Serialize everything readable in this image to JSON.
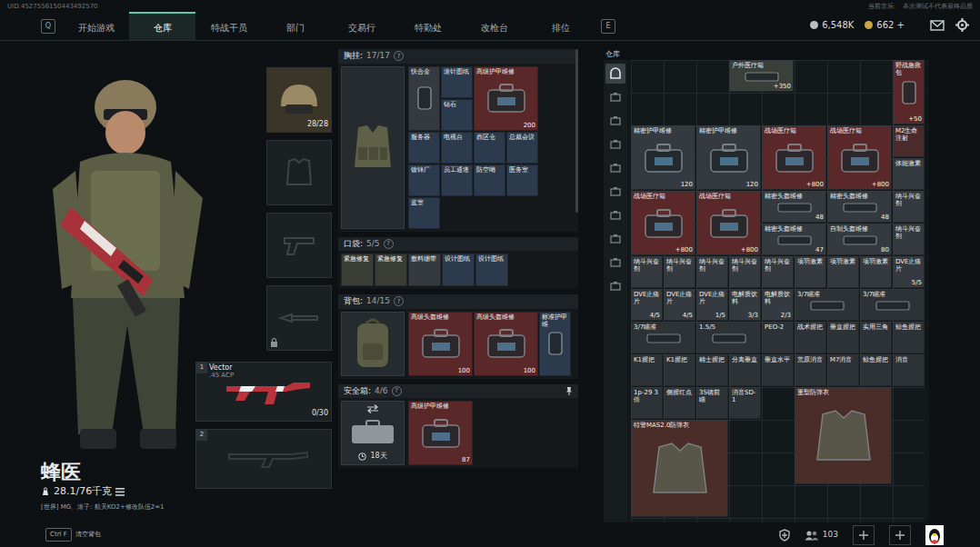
{
  "header": {
    "uid": "UID:4527556150443492570",
    "music_label": "当前音乐:",
    "notice": "本次测试不代表最终品质",
    "currencies": [
      {
        "amount": "6,548K",
        "color": "#b9bec2"
      },
      {
        "amount": "662 +",
        "color": "#c9a640"
      }
    ]
  },
  "tabs": {
    "key_left": "Q",
    "key_right": "E",
    "items": [
      {
        "label": "开始游戏",
        "selected": false
      },
      {
        "label": "仓库",
        "selected": true
      },
      {
        "label": "特战干员",
        "selected": false
      },
      {
        "label": "部门",
        "selected": false
      },
      {
        "label": "交易行",
        "selected": false
      },
      {
        "label": "特勤处",
        "selected": false
      },
      {
        "label": "改枪台",
        "selected": false
      },
      {
        "label": "排位",
        "selected": false
      }
    ]
  },
  "operator": {
    "name": "蜂医",
    "weight": "28.1/76千克",
    "chat": "[世界] MG、滚子: 航天KO2+修改队伍2=1"
  },
  "loadout": {
    "helmet_durability": "28/28",
    "primary": {
      "slot": "1",
      "name": "Vector",
      "caliber": ".45 ACP",
      "ammo": "0/30"
    },
    "secondary": {
      "slot": "2"
    }
  },
  "containers": [
    {
      "title": "胸挂:",
      "capacity": "17/17",
      "help": "?",
      "kind": "rig",
      "items": [
        {
          "name": "快合金",
          "kind": "tall",
          "color": "#343a3f"
        },
        {
          "name": "滚针图纸",
          "kind": "small",
          "color": "#2b3a4c"
        },
        {
          "name": "高级护甲维修",
          "value": "200",
          "kind": "big",
          "color": "#5a2828"
        },
        {
          "name": "钻石",
          "kind": "small",
          "color": "#2b3a4c"
        },
        {
          "name": "服务器",
          "kind": "small",
          "color": "#2b3a4c"
        },
        {
          "name": "电视台",
          "kind": "small",
          "color": "#2b3a4c"
        },
        {
          "name": "西区仓",
          "kind": "small",
          "color": "#2b3a4c"
        },
        {
          "name": "总裁会议",
          "kind": "small",
          "color": "#2b3a4c"
        },
        {
          "name": "镀锌厂",
          "kind": "small",
          "color": "#2b3a4c"
        },
        {
          "name": "员工通道",
          "kind": "small",
          "color": "#2b3a4c"
        },
        {
          "name": "防空哨",
          "kind": "small",
          "color": "#2b3a4c"
        },
        {
          "name": "医务室",
          "kind": "small",
          "color": "#2b3a4c"
        },
        {
          "name": "蓝室",
          "kind": "small",
          "color": "#2b3a4c"
        }
      ]
    },
    {
      "title": "口袋:",
      "capacity": "5/5",
      "help": "?",
      "kind": "pocket",
      "items": [
        {
          "name": "紧急修复",
          "kind": "small",
          "color": "#3a3d33"
        },
        {
          "name": "紧急修复",
          "kind": "small",
          "color": "#3a3d33"
        },
        {
          "name": "敷料绷带",
          "kind": "small",
          "color": "#343a3f"
        },
        {
          "name": "设计图纸",
          "kind": "small",
          "color": "#2b3a4c"
        },
        {
          "name": "设计图纸",
          "kind": "small",
          "color": "#2b3a4c"
        }
      ]
    },
    {
      "title": "背包:",
      "capacity": "14/15",
      "help": "?",
      "kind": "backpack",
      "items": [
        {
          "name": "高级头盔维修",
          "value": "100",
          "kind": "big",
          "color": "#5a2828"
        },
        {
          "name": "高级头盔维修",
          "value": "100",
          "kind": "big",
          "color": "#5a2828"
        },
        {
          "name": "标准护甲维",
          "kind": "tall",
          "color": "#2b3a4c"
        }
      ]
    },
    {
      "title": "安全箱:",
      "capacity": "4/6",
      "help": "?",
      "kind": "safe",
      "timer": "18天",
      "items": [
        {
          "name": "高级护甲维修",
          "value": "87",
          "kind": "big",
          "color": "#5a2828"
        }
      ]
    }
  ],
  "warehouse": {
    "title": "仓库",
    "categories": [
      {
        "selected": true
      },
      {
        "selected": false
      },
      {
        "selected": false
      },
      {
        "selected": false
      },
      {
        "selected": false
      },
      {
        "selected": false
      },
      {
        "selected": false
      },
      {
        "selected": false
      },
      {
        "selected": false
      },
      {
        "selected": false
      }
    ],
    "items": [
      {
        "kind": "empty"
      },
      {
        "kind": "empty"
      },
      {
        "kind": "empty"
      },
      {
        "name": "户外医疗箱",
        "value": "+350",
        "kind": "wide",
        "color": "#3a3f3a"
      },
      {
        "kind": "empty"
      },
      {
        "kind": "empty"
      },
      {
        "kind": "empty"
      },
      {
        "name": "野战急救包",
        "value": "+50",
        "kind": "tall",
        "color": "#5a2828"
      },
      {
        "kind": "empty"
      },
      {
        "kind": "empty"
      },
      {
        "kind": "empty"
      },
      {
        "kind": "empty"
      },
      {
        "kind": "empty"
      },
      {
        "kind": "empty"
      },
      {
        "kind": "empty"
      },
      {
        "kind": "empty"
      },
      {
        "name": "精密护甲维修",
        "value": "120",
        "kind": "big",
        "color": "#343a3f"
      },
      {
        "name": "精密护甲维修",
        "value": "120",
        "kind": "big",
        "color": "#343a3f"
      },
      {
        "name": "战场医疗箱",
        "value": "+800",
        "kind": "big",
        "color": "#5a2828"
      },
      {
        "name": "战场医疗箱",
        "value": "+800",
        "kind": "big",
        "color": "#5a2828"
      },
      {
        "name": "M2生命注射",
        "kind": "small",
        "color": "#4a2a2a"
      },
      {
        "name": "体能激素",
        "kind": "small",
        "color": "#343a3f"
      },
      {
        "name": "战场医疗箱",
        "value": "+800",
        "kind": "big",
        "color": "#5a2828"
      },
      {
        "name": "战场医疗箱",
        "value": "+800",
        "kind": "big",
        "color": "#5a2828"
      },
      {
        "name": "精密头盔维修",
        "value": "48",
        "kind": "wide",
        "color": "#343a3f"
      },
      {
        "name": "精密头盔维修",
        "value": "48",
        "kind": "wide",
        "color": "#343a3f"
      },
      {
        "name": "纳斗兴奋剂",
        "kind": "small",
        "color": "#343a3f"
      },
      {
        "name": "精密头盔维修",
        "value": "47",
        "kind": "wide",
        "color": "#343a3f"
      },
      {
        "name": "自制头盔维修",
        "value": "80",
        "kind": "wide",
        "color": "#343a3f"
      },
      {
        "name": "纳斗兴奋剂",
        "kind": "small",
        "color": "#343a3f"
      },
      {
        "name": "纳斗兴奋剂",
        "kind": "small",
        "color": "#343a3f"
      },
      {
        "name": "纳斗兴奋剂",
        "kind": "small",
        "color": "#343a3f"
      },
      {
        "name": "纳斗兴奋剂",
        "kind": "small",
        "color": "#343a3f"
      },
      {
        "name": "纳斗兴奋剂",
        "kind": "small",
        "color": "#343a3f"
      },
      {
        "name": "纳斗兴奋剂",
        "kind": "small",
        "color": "#343a3f"
      },
      {
        "name": "项羽激素",
        "kind": "small",
        "color": "#343a3f"
      },
      {
        "name": "项羽激素",
        "kind": "small",
        "color": "#343a3f"
      },
      {
        "name": "项羽激素",
        "kind": "small",
        "color": "#343a3f"
      },
      {
        "name": "DVE止痛片",
        "value": "5/5",
        "kind": "small",
        "color": "#343a3f"
      },
      {
        "name": "DVE止痛片",
        "value": "4/5",
        "kind": "small",
        "color": "#343a3f"
      },
      {
        "name": "DVE止痛片",
        "value": "4/5",
        "kind": "small",
        "color": "#343a3f"
      },
      {
        "name": "DVE止痛片",
        "value": "1/5",
        "kind": "small",
        "color": "#343a3f"
      },
      {
        "name": "电解质饮料",
        "value": "3/3",
        "kind": "small",
        "color": "#343a3f"
      },
      {
        "name": "电解质饮料",
        "value": "2/3",
        "kind": "small",
        "color": "#343a3f"
      },
      {
        "name": "3/7瞄准",
        "kind": "wide",
        "color": "#2c3236"
      },
      {
        "name": "3/7瞄准",
        "kind": "wide",
        "color": "#2c3236"
      },
      {
        "name": "3/7瞄准",
        "kind": "wide",
        "color": "#2c3236"
      },
      {
        "name": "1.5/5",
        "kind": "wide",
        "color": "#2c3236"
      },
      {
        "name": "PEO-2",
        "kind": "small",
        "color": "#2c3236"
      },
      {
        "name": "战术握把",
        "kind": "small",
        "color": "#2c3236"
      },
      {
        "name": "垂直握把",
        "kind": "small",
        "color": "#2c3236"
      },
      {
        "name": "实用三角",
        "kind": "small",
        "color": "#2c3236"
      },
      {
        "name": "鲸鱼握把",
        "kind": "small",
        "color": "#2c3236"
      },
      {
        "name": "K1握把",
        "kind": "small",
        "color": "#2c3236"
      },
      {
        "name": "K1握把",
        "kind": "small",
        "color": "#2c3236"
      },
      {
        "name": "精士握把",
        "kind": "small",
        "color": "#2c3236"
      },
      {
        "name": "分离垂直",
        "kind": "small",
        "color": "#2c3236"
      },
      {
        "name": "垂直水平",
        "kind": "small",
        "color": "#2c3236"
      },
      {
        "name": "荒原消音",
        "kind": "small",
        "color": "#2c3236"
      },
      {
        "name": "M7消音",
        "kind": "small",
        "color": "#2c3236"
      },
      {
        "name": "鲸鱼握把",
        "kind": "small",
        "color": "#2c3236"
      },
      {
        "name": "消音",
        "kind": "small",
        "color": "#2c3236"
      },
      {
        "name": "1p-29 3倍",
        "kind": "small",
        "color": "#2c3236"
      },
      {
        "name": "侧握红点",
        "kind": "small",
        "color": "#2c3236"
      },
      {
        "name": "3S镜前瞄",
        "kind": "small",
        "color": "#2c3236"
      },
      {
        "name": "消音SD-1",
        "kind": "small",
        "color": "#2c3236"
      },
      {
        "kind": "empty"
      },
      {
        "name": "重型防弹衣",
        "kind": "armor",
        "color": "#4a2c29"
      },
      {
        "name": "特警MAS2.0防弹衣",
        "kind": "armor",
        "color": "#4a2c29"
      }
    ]
  },
  "footer": {
    "key": "Ctrl F",
    "hint": "清空背包",
    "friends": "103"
  }
}
